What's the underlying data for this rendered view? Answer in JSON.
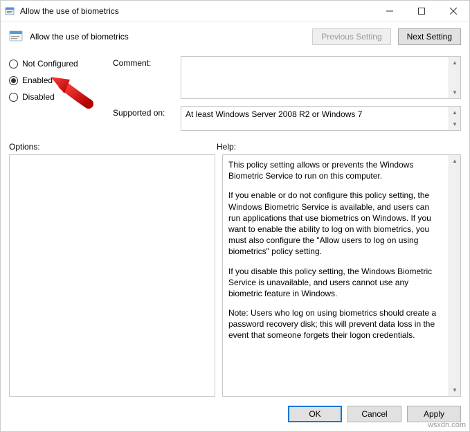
{
  "window": {
    "title": "Allow the use of biometrics"
  },
  "header": {
    "policy_title": "Allow the use of biometrics",
    "previous_setting": "Previous Setting",
    "next_setting": "Next Setting"
  },
  "radios": {
    "not_configured": "Not Configured",
    "enabled": "Enabled",
    "disabled": "Disabled",
    "selected": "enabled"
  },
  "labels": {
    "comment": "Comment:",
    "supported_on": "Supported on:",
    "options": "Options:",
    "help": "Help:"
  },
  "fields": {
    "comment": "",
    "supported_on": "At least Windows Server 2008 R2 or Windows 7"
  },
  "help": {
    "p1": "This policy setting allows or prevents the Windows Biometric Service to run on this computer.",
    "p2": "If you enable or do not configure this policy setting, the Windows Biometric Service is available, and users can run applications that use biometrics on Windows. If you want to enable the ability to log on with biometrics, you must also configure the \"Allow users to log on using biometrics\" policy setting.",
    "p3": "If you disable this policy setting, the Windows Biometric Service is unavailable, and users cannot use any biometric feature in Windows.",
    "p4": "Note: Users who log on using biometrics should create a password recovery disk; this will prevent data loss in the event that someone forgets their logon credentials."
  },
  "buttons": {
    "ok": "OK",
    "cancel": "Cancel",
    "apply": "Apply"
  },
  "watermark": "wsxdn.com"
}
